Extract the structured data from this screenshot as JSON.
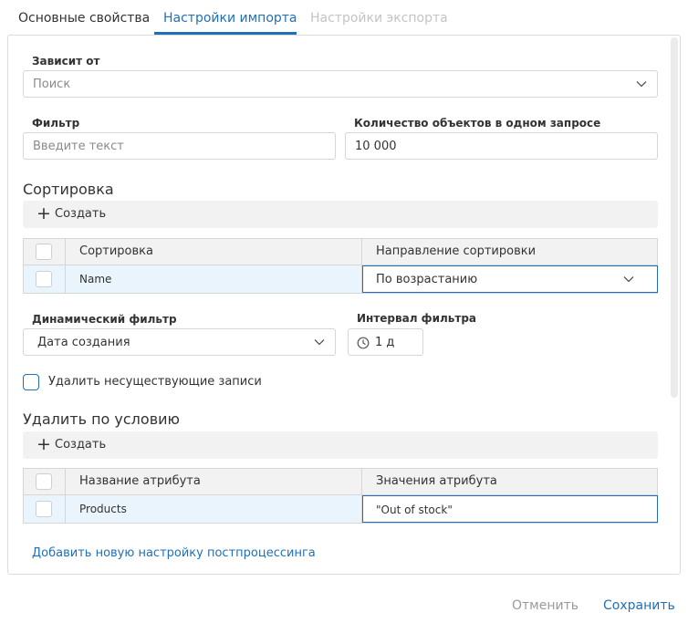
{
  "tabs": [
    {
      "label": "Основные свойства",
      "state": "normal"
    },
    {
      "label": "Настройки импорта",
      "state": "active"
    },
    {
      "label": "Настройки экспорта",
      "state": "disabled"
    }
  ],
  "depends_on": {
    "label": "Зависит от",
    "placeholder": "Поиск"
  },
  "filter": {
    "label": "Фильтр",
    "placeholder": "Введите текст"
  },
  "batch_size": {
    "label": "Количество объектов в одном запросе",
    "value": "10 000"
  },
  "sorting": {
    "title": "Сортировка",
    "add_label": "Создать",
    "columns": [
      "Сортировка",
      "Направление сортировки"
    ],
    "rows": [
      {
        "field": "Name",
        "direction": "По возрастанию"
      }
    ]
  },
  "dynamic_filter": {
    "label": "Динамический фильтр",
    "value": "Дата создания"
  },
  "filter_interval": {
    "label": "Интервал фильтра",
    "value": "1 д"
  },
  "delete_nonexistent": {
    "label": "Удалить несуществующие записи",
    "checked": false
  },
  "delete_by_condition": {
    "title": "Удалить по условию",
    "add_label": "Создать",
    "columns": [
      "Название атрибута",
      "Значения атрибута"
    ],
    "rows": [
      {
        "attribute": "Products",
        "value": "\"Out of stock\""
      }
    ]
  },
  "postprocessing_link": "Добавить новую настройку постпроцессинга",
  "footer": {
    "cancel": "Отменить",
    "save": "Сохранить"
  },
  "colors": {
    "accent": "#1f70b8",
    "selected_row": "#e9f4fc",
    "disabled_text": "#c4c4c4"
  },
  "icons": [
    "chevron-down-icon",
    "plus-icon",
    "clock-icon"
  ]
}
